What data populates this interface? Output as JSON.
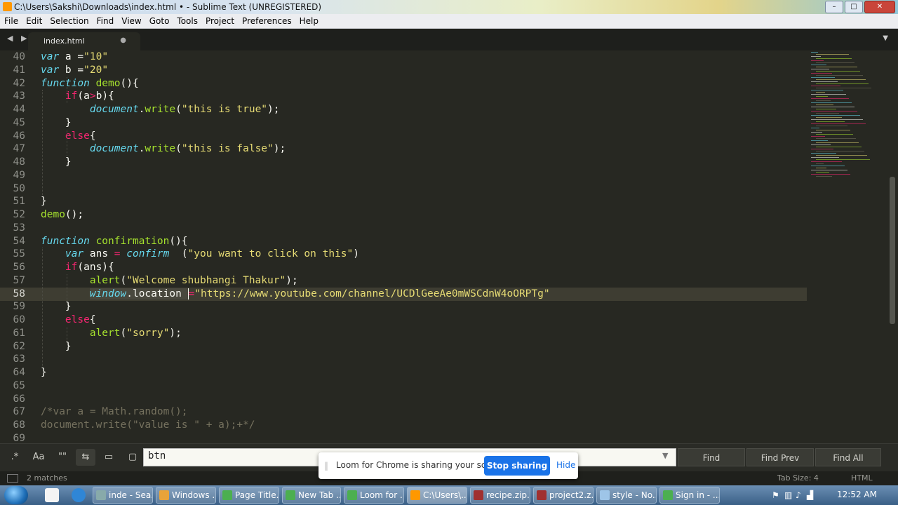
{
  "window": {
    "title": "C:\\Users\\Sakshi\\Downloads\\index.html • - Sublime Text (UNREGISTERED)",
    "controls": [
      "–",
      "□",
      "✕"
    ]
  },
  "menu": [
    "File",
    "Edit",
    "Selection",
    "Find",
    "View",
    "Goto",
    "Tools",
    "Project",
    "Preferences",
    "Help"
  ],
  "tabs": {
    "nav": "◀ ▶",
    "active": {
      "label": "index.html",
      "modified_marker": "●"
    },
    "dropdown": "▼"
  },
  "editor": {
    "active_line": 58,
    "lines": [
      {
        "n": "40",
        "tokens": [
          [
            "k",
            "var"
          ],
          [
            "p",
            " a ="
          ],
          [
            "s",
            "\"10\""
          ]
        ]
      },
      {
        "n": "41",
        "tokens": [
          [
            "k",
            "var"
          ],
          [
            "p",
            " b ="
          ],
          [
            "s",
            "\"20\""
          ]
        ]
      },
      {
        "n": "42",
        "tokens": [
          [
            "k",
            "function"
          ],
          [
            "p",
            " "
          ],
          [
            "f",
            "demo"
          ],
          [
            "p",
            "(){"
          ]
        ]
      },
      {
        "n": "43",
        "tokens": [
          [
            "p",
            "    "
          ],
          [
            "kw",
            "if"
          ],
          [
            "p",
            "(a"
          ],
          [
            "kw",
            ">"
          ],
          [
            "p",
            "b){"
          ]
        ]
      },
      {
        "n": "44",
        "tokens": [
          [
            "p",
            "        "
          ],
          [
            "k",
            "document"
          ],
          [
            "p",
            "."
          ],
          [
            "f",
            "write"
          ],
          [
            "p",
            "("
          ],
          [
            "s",
            "\"this is true\""
          ],
          [
            "p",
            ");"
          ]
        ]
      },
      {
        "n": "45",
        "tokens": [
          [
            "p",
            "    }"
          ]
        ]
      },
      {
        "n": "46",
        "tokens": [
          [
            "p",
            "    "
          ],
          [
            "kw",
            "else"
          ],
          [
            "p",
            "{"
          ]
        ]
      },
      {
        "n": "47",
        "tokens": [
          [
            "p",
            "        "
          ],
          [
            "k",
            "document"
          ],
          [
            "p",
            "."
          ],
          [
            "f",
            "write"
          ],
          [
            "p",
            "("
          ],
          [
            "s",
            "\"this is false\""
          ],
          [
            "p",
            ");"
          ]
        ]
      },
      {
        "n": "48",
        "tokens": [
          [
            "p",
            "    }"
          ]
        ]
      },
      {
        "n": "49",
        "tokens": []
      },
      {
        "n": "50",
        "tokens": []
      },
      {
        "n": "51",
        "tokens": [
          [
            "p",
            "}"
          ]
        ]
      },
      {
        "n": "52",
        "tokens": [
          [
            "f",
            "demo"
          ],
          [
            "p",
            "();"
          ]
        ]
      },
      {
        "n": "53",
        "tokens": []
      },
      {
        "n": "54",
        "tokens": [
          [
            "k",
            "function"
          ],
          [
            "p",
            " "
          ],
          [
            "f",
            "confirmation"
          ],
          [
            "p",
            "(){"
          ]
        ]
      },
      {
        "n": "55",
        "tokens": [
          [
            "p",
            "    "
          ],
          [
            "k",
            "var"
          ],
          [
            "p",
            " ans "
          ],
          [
            "kw",
            "="
          ],
          [
            "p",
            " "
          ],
          [
            "k",
            "confirm"
          ],
          [
            "p",
            "  ("
          ],
          [
            "s",
            "\"you want to click on this\""
          ],
          [
            "p",
            ")"
          ]
        ]
      },
      {
        "n": "56",
        "tokens": [
          [
            "p",
            "    "
          ],
          [
            "kw",
            "if"
          ],
          [
            "p",
            "(ans){"
          ]
        ]
      },
      {
        "n": "57",
        "tokens": [
          [
            "p",
            "        "
          ],
          [
            "f",
            "alert"
          ],
          [
            "p",
            "("
          ],
          [
            "s",
            "\"Welcome shubhangi Thakur\""
          ],
          [
            "p",
            ");"
          ]
        ]
      },
      {
        "n": "58",
        "tokens": [
          [
            "p",
            "        "
          ],
          [
            "ksel",
            "window"
          ],
          [
            "psel",
            ".location "
          ],
          [
            "caret",
            ""
          ],
          [
            "kw",
            "="
          ],
          [
            "s",
            "\"https://www.youtube.com/channel/UCDlGeeAe0mWSCdnW4oORPTg\""
          ]
        ]
      },
      {
        "n": "59",
        "tokens": [
          [
            "p",
            "    }"
          ]
        ]
      },
      {
        "n": "60",
        "tokens": [
          [
            "p",
            "    "
          ],
          [
            "kw",
            "else"
          ],
          [
            "p",
            "{"
          ]
        ]
      },
      {
        "n": "61",
        "tokens": [
          [
            "p",
            "        "
          ],
          [
            "f",
            "alert"
          ],
          [
            "p",
            "("
          ],
          [
            "s",
            "\"sorry\""
          ],
          [
            "p",
            ");"
          ]
        ]
      },
      {
        "n": "62",
        "tokens": [
          [
            "p",
            "    }"
          ]
        ]
      },
      {
        "n": "63",
        "tokens": []
      },
      {
        "n": "64",
        "tokens": [
          [
            "p",
            "}"
          ]
        ]
      },
      {
        "n": "65",
        "tokens": []
      },
      {
        "n": "66",
        "tokens": []
      },
      {
        "n": "67",
        "tokens": [
          [
            "c",
            "/*var a = Math.random();"
          ]
        ]
      },
      {
        "n": "68",
        "tokens": [
          [
            "c",
            "document.write(\"value is \" + a);+*/"
          ]
        ]
      },
      {
        "n": "69",
        "tokens": []
      }
    ]
  },
  "find_panel": {
    "option_icons": [
      ".*",
      "Aa",
      "\"\"",
      "⇆",
      "▭",
      "▢"
    ],
    "query": "btn",
    "buttons": [
      "Find",
      "Find Prev",
      "Find All"
    ]
  },
  "status": {
    "matches": "2 matches",
    "tab_size": "Tab Size: 4",
    "syntax": "HTML"
  },
  "loom": {
    "message": "Loom for Chrome is sharing your screen.",
    "stop": "Stop sharing",
    "hide": "Hide"
  },
  "taskbar": {
    "tasks": [
      {
        "label": "inde - Sea...",
        "color": "#8aa"
      },
      {
        "label": "Windows ...",
        "color": "#e8a33a"
      },
      {
        "label": "Page Title...",
        "color": "#4caf50"
      },
      {
        "label": "New Tab ...",
        "color": "#4caf50"
      },
      {
        "label": "Loom for ...",
        "color": "#4caf50"
      },
      {
        "label": "C:\\Users\\...",
        "color": "#ff9800"
      },
      {
        "label": "recipe.zip...",
        "color": "#a03030"
      },
      {
        "label": "project2.z...",
        "color": "#a03030"
      },
      {
        "label": "style - No...",
        "color": "#9ec5e8"
      },
      {
        "label": "Sign in - ...",
        "color": "#4caf50"
      }
    ],
    "clock": "12:52 AM"
  }
}
